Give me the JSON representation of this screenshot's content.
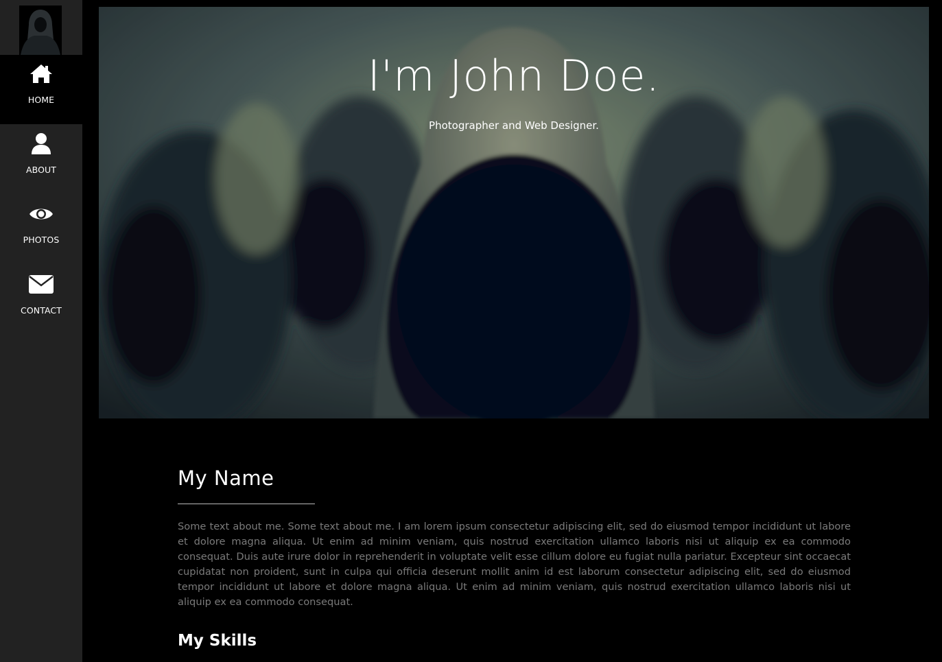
{
  "nav": {
    "items": [
      {
        "label": "HOME",
        "icon": "home-icon",
        "active": true
      },
      {
        "label": "ABOUT",
        "icon": "user-icon",
        "active": false
      },
      {
        "label": "PHOTOS",
        "icon": "eye-icon",
        "active": false
      },
      {
        "label": "CONTACT",
        "icon": "envelope-icon",
        "active": false
      }
    ]
  },
  "hero": {
    "title": "I'm John Doe.",
    "subtitle": "Photographer and Web Designer."
  },
  "about": {
    "heading": "My Name",
    "paragraph": "Some text about me. Some text about me. I am lorem ipsum consectetur adipiscing elit, sed do eiusmod tempor incididunt ut labore et dolore magna aliqua. Ut enim ad minim veniam, quis nostrud exercitation ullamco laboris nisi ut aliquip ex ea commodo consequat. Duis aute irure dolor in reprehenderit in voluptate velit esse cillum dolore eu fugiat nulla pariatur. Excepteur sint occaecat cupidatat non proident, sunt in culpa qui officia deserunt mollit anim id est laborum consectetur adipiscing elit, sed do eiusmod tempor incididunt ut labore et dolore magna aliqua. Ut enim ad minim veniam, quis nostrud exercitation ullamco laboris nisi ut aliquip ex ea commodo consequat.",
    "skills_heading": "My Skills"
  },
  "colors": {
    "sidebar_bg": "#222222",
    "active_bg": "#000000",
    "page_bg": "#000000",
    "body_text": "#7a7a7a"
  }
}
